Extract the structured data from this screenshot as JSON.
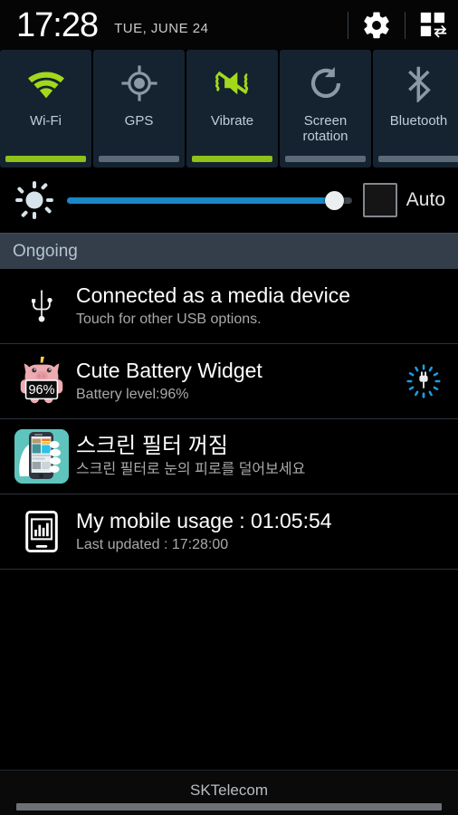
{
  "statusbar": {
    "time": "17:28",
    "date": "TUE, JUNE 24",
    "settings_icon": "gear-icon",
    "panel_toggle_icon": "quick-settings-grid-icon"
  },
  "quick_settings": {
    "tiles": [
      {
        "label": "Wi-Fi",
        "icon": "wifi-icon",
        "active": true
      },
      {
        "label": "GPS",
        "icon": "gps-crosshair-icon",
        "active": false
      },
      {
        "label": "Vibrate",
        "icon": "vibrate-icon",
        "active": true
      },
      {
        "label": "Screen rotation",
        "icon": "rotate-icon",
        "active": false
      },
      {
        "label": "Bluetooth",
        "icon": "bluetooth-icon",
        "active": false
      }
    ],
    "active_color": "#8ec11a",
    "inactive_color": "#5b6a78",
    "tile_background": "#152330"
  },
  "brightness": {
    "icon": "brightness-sun-icon",
    "value_percent": 94,
    "fill_color": "#1a87c8",
    "auto_label": "Auto",
    "auto_checked": false
  },
  "section_header": {
    "label": "Ongoing"
  },
  "notifications": [
    {
      "icon": "usb-icon",
      "title": "Connected as a media device",
      "subtitle": "Touch for other USB options."
    },
    {
      "icon": "pig-battery-icon",
      "badge_text": "96%",
      "title": "Cute Battery Widget",
      "subtitle": "Battery level:96%",
      "right_icon": "charging-plug-icon"
    },
    {
      "icon": "screen-filter-app-icon",
      "title": "스크린 필터 꺼짐",
      "subtitle": "스크린 필터로 눈의 피로를 덜어보세요"
    },
    {
      "icon": "mobile-usage-icon",
      "title": "My mobile usage : 01:05:54",
      "subtitle": "Last updated : 17:28:00"
    }
  ],
  "footer": {
    "carrier": "SKTelecom"
  }
}
